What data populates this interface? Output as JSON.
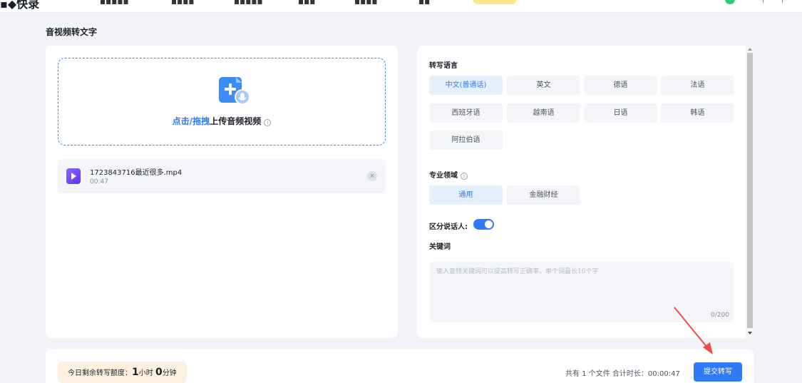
{
  "topnav": {
    "logo": "▪◆快录",
    "items": [
      "▪▪▪▪▪",
      "▪▪▪▪",
      "▪▪▪▪▪",
      "▪▪▪",
      "▪▪▪▪",
      "▪▪"
    ]
  },
  "page_title": "音视频转文字",
  "upload": {
    "link_text": "点击/拖拽",
    "rest_text": "上传音频视频"
  },
  "file": {
    "name": "1723843716最近很多.mp4",
    "duration": "00:47",
    "remove": "×"
  },
  "language": {
    "label": "转写语言",
    "options": [
      "中文(普通话)",
      "英文",
      "德语",
      "法语",
      "西班牙语",
      "越南语",
      "日语",
      "韩语",
      "阿拉伯语"
    ],
    "selected": "中文(普通话)"
  },
  "domain_field": {
    "label": "专业领域",
    "options": [
      "通用",
      "金融财经"
    ],
    "selected": "通用"
  },
  "speaker": {
    "label": "区分说话人:",
    "enabled": true
  },
  "keywords": {
    "label": "关键词",
    "placeholder": "输入音频关键词可以提高转写正确率，单个词最长10个字",
    "value": "",
    "count": "0/200"
  },
  "quota": {
    "prefix": "今日剩余转写额度：",
    "hours": "1",
    "hours_unit": "小时",
    "minutes": "0",
    "minutes_unit": "分钟"
  },
  "summary": "共有 1 个文件 合计时长：00:00:47",
  "submit_label": "提交转写",
  "colors": {
    "accent": "#2f7bf5",
    "annotation_arrow": "#f04a4a"
  }
}
